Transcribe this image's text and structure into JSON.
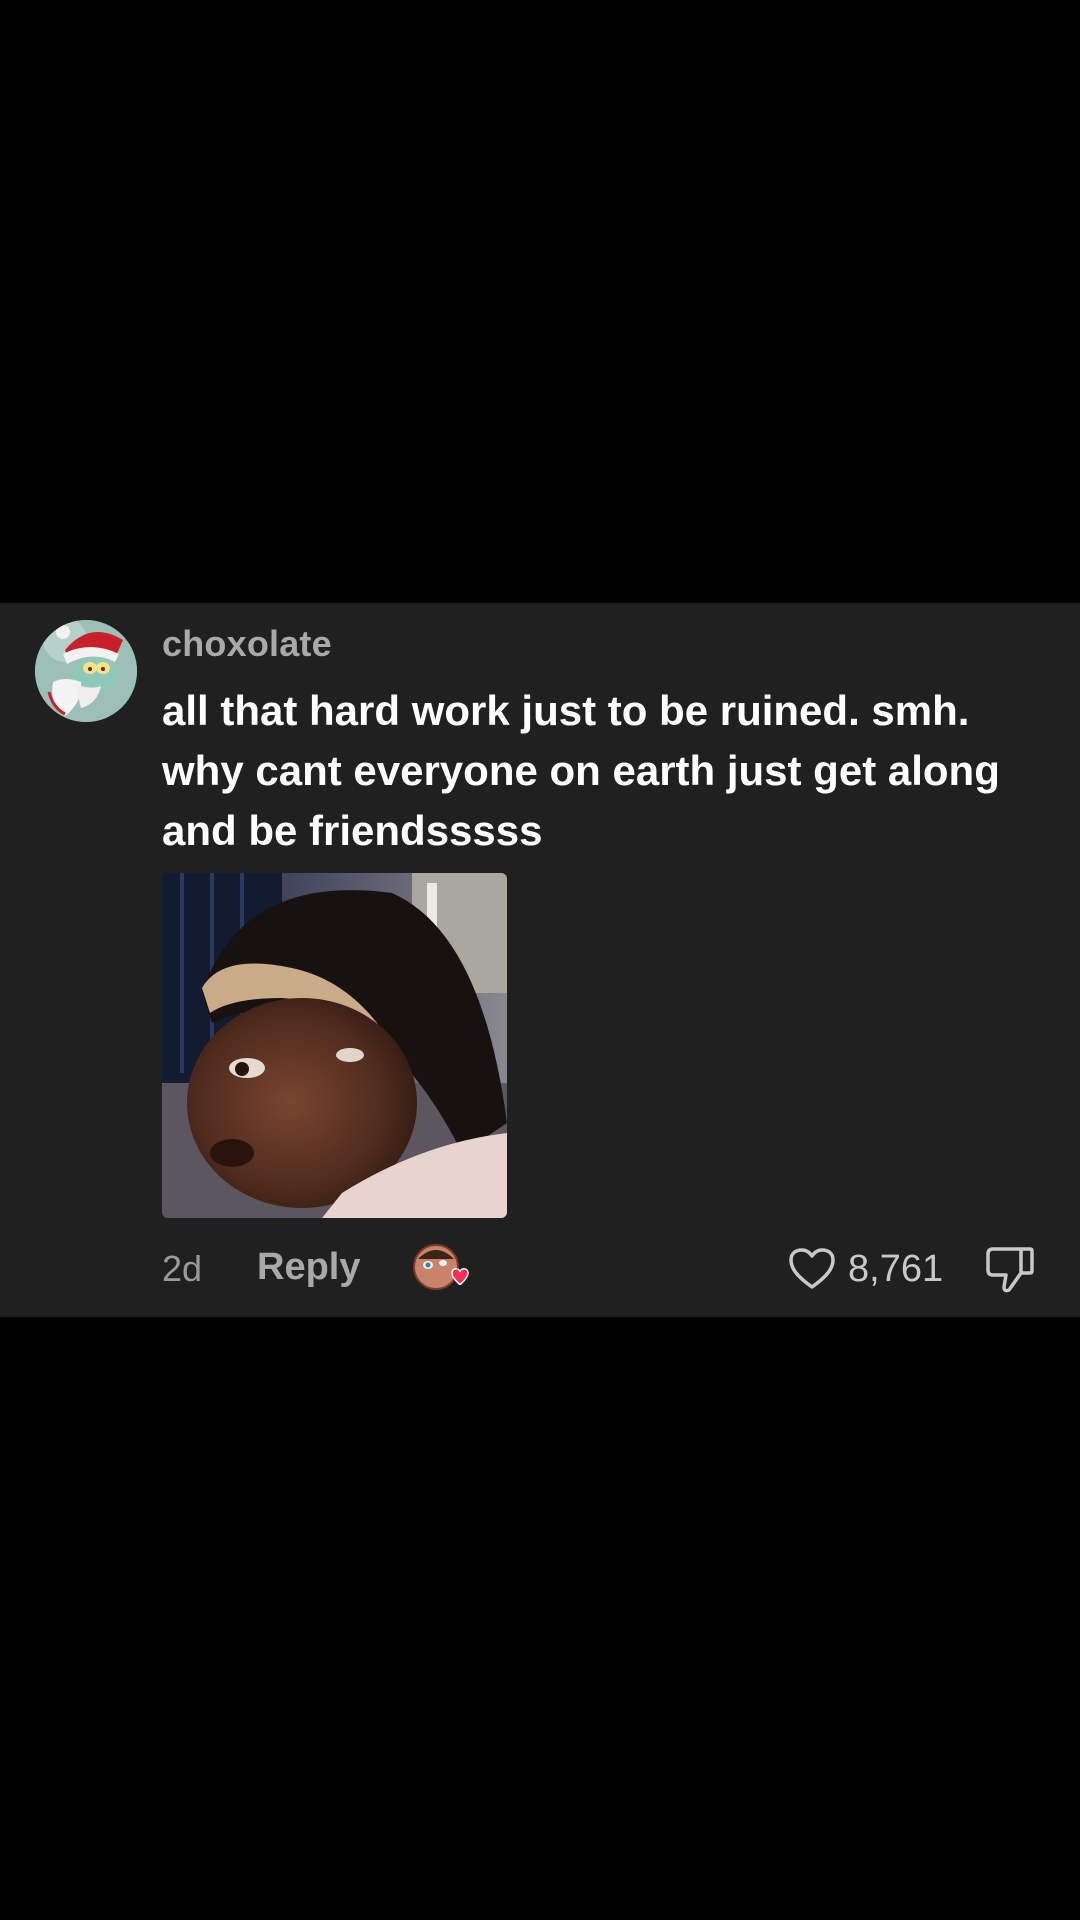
{
  "comment": {
    "username": "choxolate",
    "text": "all that hard work just to be ruined. smh. why cant everyone on earth just get along and be friendsssss",
    "time": "2d",
    "reply_label": "Reply",
    "like_count": "8,761",
    "icons": {
      "avatar": "squidward-santa-avatar",
      "image": "reaction-photo",
      "creator_liked": "creator-liked-heart-icon",
      "like": "heart-outline-icon",
      "dislike": "thumbs-down-icon"
    },
    "colors": {
      "card_background": "#202020",
      "page_background": "#000000",
      "username": "#a9a9a9",
      "text": "#ffffff",
      "meta": "#9a9a9a",
      "heart_badge": "#ff2d55"
    }
  }
}
